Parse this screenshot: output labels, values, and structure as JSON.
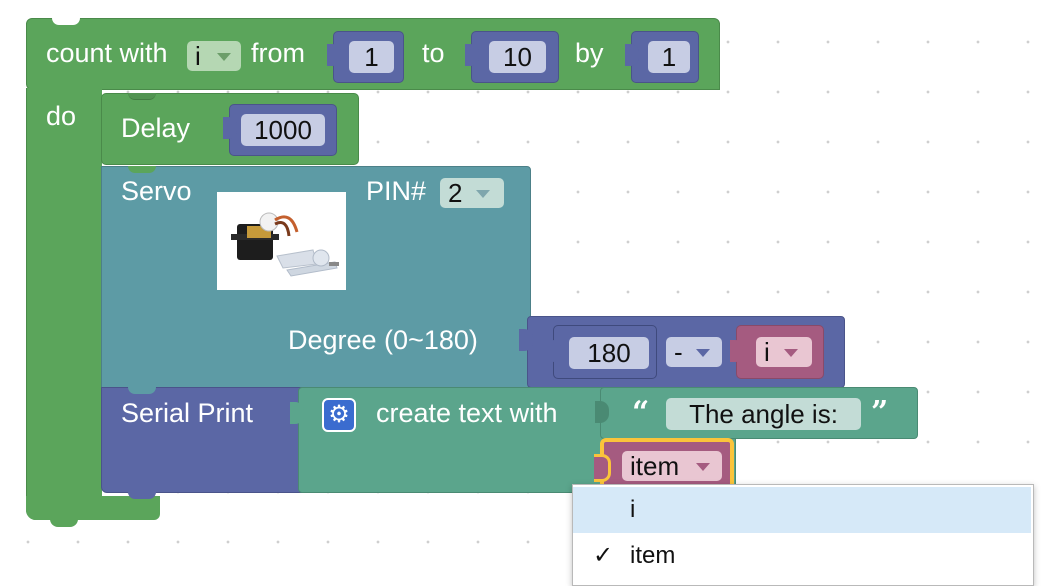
{
  "colors": {
    "loop_green": "#5ba55b",
    "servo_teal": "#5d9ba5",
    "serial_purple": "#5b67a5",
    "text_green": "#5ba58c",
    "math_purple": "#5b67a5",
    "var_pink": "#a55b80",
    "highlight_yellow": "#fbc43b",
    "menu_selected": "#d6e9f8"
  },
  "count_block": {
    "label_count_with": "count with",
    "variable": "i",
    "label_from": "from",
    "from_value": "1",
    "label_to": "to",
    "to_value": "10",
    "label_by": "by",
    "by_value": "1",
    "label_do": "do"
  },
  "delay_block": {
    "label": "Delay",
    "value": "1000"
  },
  "servo_block": {
    "label": "Servo",
    "pin_label": "PIN#",
    "pin_value": "2",
    "degree_label": "Degree (0~180)",
    "image_icon": "servo-motor-image"
  },
  "math_block": {
    "left_value": "180",
    "operator": "-",
    "right_variable": "i"
  },
  "serial_block": {
    "label": "Serial Print",
    "create_text_label": "create text with",
    "gear_icon": "gear-icon",
    "open_quote": "“",
    "text_value": "The angle is:",
    "close_quote": "”",
    "item_variable": "item"
  },
  "dropdown_menu": {
    "items": [
      {
        "label": "i",
        "checked": false,
        "highlighted": true
      },
      {
        "label": "item",
        "checked": true,
        "highlighted": false
      }
    ],
    "check_mark": "✓"
  }
}
